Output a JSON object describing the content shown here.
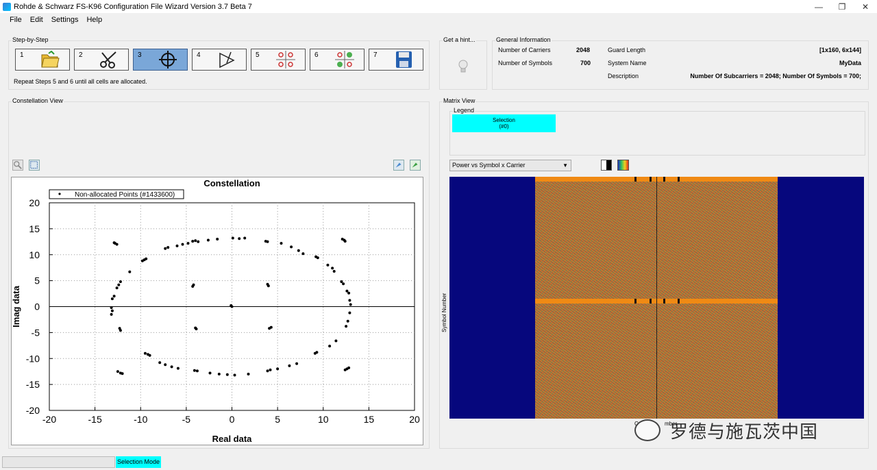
{
  "window": {
    "title": "Rohde & Schwarz FS-K96 Configuration File Wizard Version 3.7 Beta 7"
  },
  "menu": [
    "File",
    "Edit",
    "Settings",
    "Help"
  ],
  "steps_group": {
    "label": "Step-by-Step",
    "steps": [
      {
        "num": "1",
        "icon": "folder-open-icon"
      },
      {
        "num": "2",
        "icon": "scissors-icon"
      },
      {
        "num": "3",
        "icon": "crosshair-icon"
      },
      {
        "num": "4",
        "icon": "pen-vector-icon"
      },
      {
        "num": "5",
        "icon": "link-grid-icon"
      },
      {
        "num": "6",
        "icon": "link-grid-green-icon"
      },
      {
        "num": "7",
        "icon": "save-disk-icon"
      }
    ],
    "active_step": "3",
    "hint": "Repeat Steps 5 and 6 until all cells are allocated."
  },
  "hint_group": {
    "label": "Get a hint..."
  },
  "general_info": {
    "label": "General Information",
    "num_carriers_label": "Number of Carriers",
    "num_carriers": "2048",
    "num_symbols_label": "Number of Symbols",
    "num_symbols": "700",
    "guard_length_label": "Guard Length",
    "guard_length": "[1x160, 6x144]",
    "system_name_label": "System Name",
    "system_name": "MyData",
    "description_label": "Description",
    "description": "Number Of Subcarriers = 2048; Number Of Symbols = 700;"
  },
  "constellation_view": {
    "label": "Constellation View"
  },
  "matrix_view": {
    "label": "Matrix View",
    "legend_label": "Legend",
    "selection_label": "Selection",
    "selection_count": "(#0)",
    "dropdown_value": "Power vs Symbol x Carrier",
    "y_axis_label": "Symbol Number",
    "x_axis_label_visible": "C",
    "x_axis_label_tail": "mber"
  },
  "chart_data": {
    "type": "scatter",
    "title": "Constellation",
    "xlabel": "Real data",
    "ylabel": "Imag data",
    "xlim": [
      -20,
      20
    ],
    "ylim": [
      -20,
      20
    ],
    "xticks": [
      -20,
      -15,
      -10,
      -5,
      0,
      5,
      10,
      15,
      20
    ],
    "yticks": [
      20,
      15,
      10,
      5,
      0,
      -5,
      -10,
      -15,
      -20
    ],
    "grid": true,
    "legend": "top-left",
    "series": [
      {
        "name": "Non-allocated Points (#1433600)",
        "points": [
          [
            -12.8,
            12.2
          ],
          [
            -12.6,
            12.0
          ],
          [
            -12.9,
            12.3
          ],
          [
            12.1,
            13.0
          ],
          [
            12.3,
            12.8
          ],
          [
            12.4,
            12.6
          ],
          [
            -12.5,
            -12.5
          ],
          [
            -12.2,
            -12.8
          ],
          [
            -12.0,
            -12.9
          ],
          [
            12.6,
            -12.0
          ],
          [
            12.8,
            -11.8
          ],
          [
            12.4,
            -12.2
          ],
          [
            -9.6,
            9.0
          ],
          [
            -9.8,
            8.8
          ],
          [
            -9.4,
            9.2
          ],
          [
            -9.2,
            -9.2
          ],
          [
            -9.5,
            -9.0
          ],
          [
            -9.0,
            -9.4
          ],
          [
            9.2,
            9.6
          ],
          [
            9.4,
            9.4
          ],
          [
            9.1,
            -9.0
          ],
          [
            9.3,
            -8.8
          ],
          [
            -4.3,
            12.6
          ],
          [
            -4.0,
            12.7
          ],
          [
            -3.7,
            12.5
          ],
          [
            -2.6,
            12.8
          ],
          [
            -1.6,
            13.0
          ],
          [
            0.1,
            13.2
          ],
          [
            0.8,
            13.1
          ],
          [
            1.4,
            13.2
          ],
          [
            3.7,
            12.6
          ],
          [
            3.9,
            12.5
          ],
          [
            5.4,
            12.2
          ],
          [
            6.5,
            11.5
          ],
          [
            7.3,
            10.8
          ],
          [
            7.8,
            10.2
          ],
          [
            -7.3,
            11.2
          ],
          [
            -7.0,
            11.4
          ],
          [
            -6.0,
            11.7
          ],
          [
            -5.4,
            12.0
          ],
          [
            -4.8,
            12.2
          ],
          [
            -12.2,
            4.8
          ],
          [
            -12.4,
            4.2
          ],
          [
            -12.6,
            3.6
          ],
          [
            -12.9,
            2.0
          ],
          [
            -13.1,
            1.5
          ],
          [
            -13.2,
            -0.2
          ],
          [
            -13.1,
            -0.8
          ],
          [
            -13.2,
            -1.5
          ],
          [
            -12.3,
            -4.2
          ],
          [
            -12.2,
            -4.6
          ],
          [
            -11.2,
            6.7
          ],
          [
            -7.9,
            -10.8
          ],
          [
            -7.3,
            -11.2
          ],
          [
            -6.6,
            -11.6
          ],
          [
            -5.9,
            -11.9
          ],
          [
            12.0,
            4.8
          ],
          [
            12.2,
            4.4
          ],
          [
            12.6,
            3.0
          ],
          [
            12.8,
            2.6
          ],
          [
            12.9,
            1.2
          ],
          [
            13.0,
            0.4
          ],
          [
            12.9,
            -1.2
          ],
          [
            12.7,
            -2.8
          ],
          [
            12.5,
            -3.8
          ],
          [
            11.4,
            -6.6
          ],
          [
            10.7,
            -7.6
          ],
          [
            11.2,
            6.8
          ],
          [
            11.0,
            7.4
          ],
          [
            10.5,
            8.0
          ],
          [
            -4.1,
            -12.3
          ],
          [
            -3.8,
            -12.4
          ],
          [
            -2.4,
            -12.8
          ],
          [
            -1.4,
            -13.0
          ],
          [
            -0.5,
            -13.1
          ],
          [
            0.3,
            -13.2
          ],
          [
            1.8,
            -13.0
          ],
          [
            3.9,
            -12.4
          ],
          [
            4.2,
            -12.2
          ],
          [
            5.0,
            -12.0
          ],
          [
            6.3,
            -11.4
          ],
          [
            7.1,
            -11.0
          ],
          [
            -4.2,
            4.2
          ],
          [
            -4.3,
            3.9
          ],
          [
            3.9,
            4.3
          ],
          [
            4.0,
            4.0
          ],
          [
            -4.0,
            -4.1
          ],
          [
            -3.9,
            -4.3
          ],
          [
            4.3,
            -4.0
          ],
          [
            4.1,
            -4.2
          ],
          [
            0.0,
            0.0
          ],
          [
            -0.1,
            0.2
          ]
        ]
      }
    ]
  },
  "status": {
    "mode": "Selection Mode"
  },
  "watermark": {
    "text": "罗德与施瓦茨中国"
  },
  "colors": {
    "accent": "#00ffff",
    "matrix_bg": "#06077d",
    "band": "#f08a14",
    "step_active": "#7aa7d8"
  }
}
